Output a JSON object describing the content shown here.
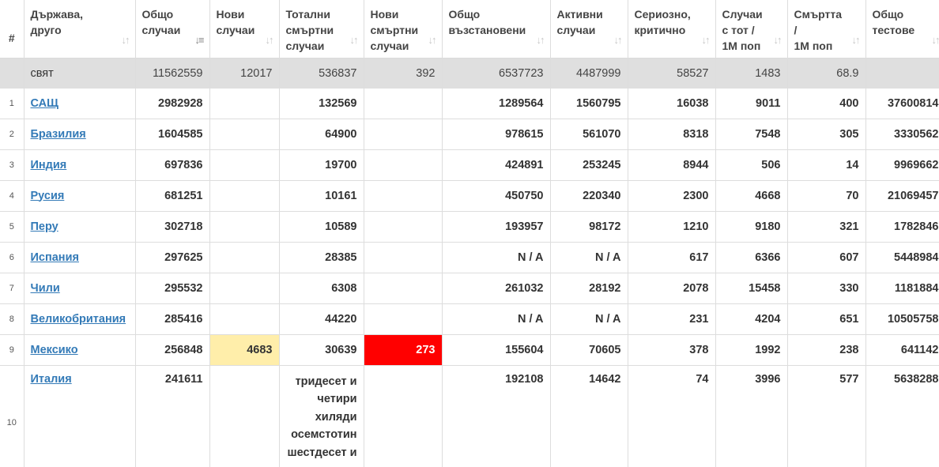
{
  "headers": [
    {
      "key": "num",
      "label": "#"
    },
    {
      "key": "country",
      "label": "Държава,\nдруго"
    },
    {
      "key": "total_cases",
      "label": "Общо\nслучаи"
    },
    {
      "key": "new_cases",
      "label": "Нови\nслучаи"
    },
    {
      "key": "total_deaths",
      "label": "Тотални\nсмъртни\nслучаи"
    },
    {
      "key": "new_deaths",
      "label": "Нови\nсмъртни\nслучаи"
    },
    {
      "key": "total_recovered",
      "label": "Общо\nвъзстановени"
    },
    {
      "key": "active",
      "label": "Активни\nслучаи"
    },
    {
      "key": "critical",
      "label": "Сериозно,\nкритично"
    },
    {
      "key": "cases_1m",
      "label": "Случаи\nс тот /\n1M поп"
    },
    {
      "key": "deaths_1m",
      "label": "Смъртта\n/\n1M поп"
    },
    {
      "key": "tests",
      "label": "Общо\nтестове"
    }
  ],
  "world": {
    "country": "свят",
    "total_cases": "11562559",
    "new_cases": "12017",
    "total_deaths": "536837",
    "new_deaths": "392",
    "total_recovered": "6537723",
    "active": "4487999",
    "critical": "58527",
    "cases_1m": "1483",
    "deaths_1m": "68.9",
    "tests": ""
  },
  "rows": [
    {
      "num": "1",
      "country": "САЩ",
      "total_cases": "2982928",
      "new_cases": "",
      "total_deaths": "132569",
      "new_deaths": "",
      "total_recovered": "1289564",
      "active": "1560795",
      "critical": "16038",
      "cases_1m": "9011",
      "deaths_1m": "400",
      "tests": "37600814"
    },
    {
      "num": "2",
      "country": "Бразилия",
      "total_cases": "1604585",
      "new_cases": "",
      "total_deaths": "64900",
      "new_deaths": "",
      "total_recovered": "978615",
      "active": "561070",
      "critical": "8318",
      "cases_1m": "7548",
      "deaths_1m": "305",
      "tests": "3330562"
    },
    {
      "num": "3",
      "country": "Индия",
      "total_cases": "697836",
      "new_cases": "",
      "total_deaths": "19700",
      "new_deaths": "",
      "total_recovered": "424891",
      "active": "253245",
      "critical": "8944",
      "cases_1m": "506",
      "deaths_1m": "14",
      "tests": "9969662"
    },
    {
      "num": "4",
      "country": "Русия",
      "total_cases": "681251",
      "new_cases": "",
      "total_deaths": "10161",
      "new_deaths": "",
      "total_recovered": "450750",
      "active": "220340",
      "critical": "2300",
      "cases_1m": "4668",
      "deaths_1m": "70",
      "tests": "21069457"
    },
    {
      "num": "5",
      "country": "Перу",
      "total_cases": "302718",
      "new_cases": "",
      "total_deaths": "10589",
      "new_deaths": "",
      "total_recovered": "193957",
      "active": "98172",
      "critical": "1210",
      "cases_1m": "9180",
      "deaths_1m": "321",
      "tests": "1782846"
    },
    {
      "num": "6",
      "country": "Испания",
      "total_cases": "297625",
      "new_cases": "",
      "total_deaths": "28385",
      "new_deaths": "",
      "total_recovered": "N / A",
      "active": "N / A",
      "critical": "617",
      "cases_1m": "6366",
      "deaths_1m": "607",
      "tests": "5448984"
    },
    {
      "num": "7",
      "country": "Чили",
      "total_cases": "295532",
      "new_cases": "",
      "total_deaths": "6308",
      "new_deaths": "",
      "total_recovered": "261032",
      "active": "28192",
      "critical": "2078",
      "cases_1m": "15458",
      "deaths_1m": "330",
      "tests": "1181884"
    },
    {
      "num": "8",
      "country": "Великобритания",
      "total_cases": "285416",
      "new_cases": "",
      "total_deaths": "44220",
      "new_deaths": "",
      "total_recovered": "N / A",
      "active": "N / A",
      "critical": "231",
      "cases_1m": "4204",
      "deaths_1m": "651",
      "tests": "10505758"
    },
    {
      "num": "9",
      "country": "Мексико",
      "total_cases": "256848",
      "new_cases": "4683",
      "total_deaths": "30639",
      "new_deaths": "273",
      "total_recovered": "155604",
      "active": "70605",
      "critical": "378",
      "cases_1m": "1992",
      "deaths_1m": "238",
      "tests": "641142"
    },
    {
      "num": "10",
      "country": "Италия",
      "total_cases": "241611",
      "new_cases": "",
      "total_deaths": "тридесет и четири хиляди осемстотин шестдесет и един",
      "new_deaths": "",
      "total_recovered": "192108",
      "active": "14642",
      "critical": "74",
      "cases_1m": "3996",
      "deaths_1m": "577",
      "tests": "5638288"
    }
  ],
  "colors": {
    "new_cases_bg": "#ffeeaa",
    "new_deaths_bg": "#ff0000",
    "world_bg": "#dfdfdf",
    "link": "#337ab7"
  }
}
